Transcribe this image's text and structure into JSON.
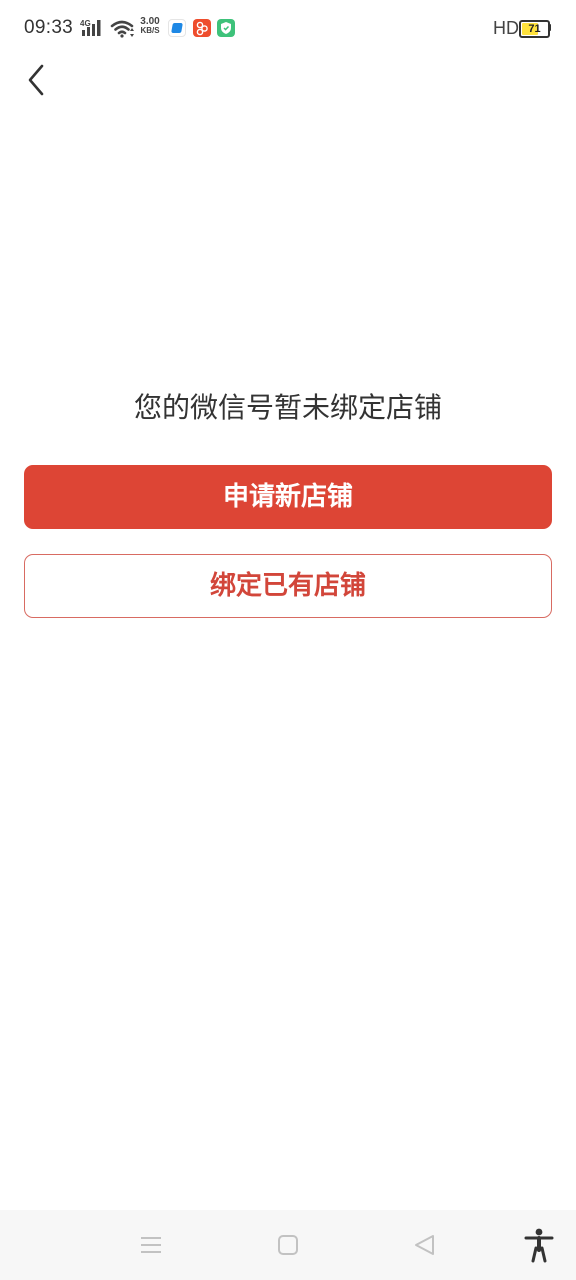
{
  "status_bar": {
    "time": "09:33",
    "network_type": "4G",
    "net_speed_value": "3.00",
    "net_speed_unit": "KB/S",
    "hd_label": "HD",
    "battery_level": "71",
    "battery_fraction": 0.71,
    "battery_fill_color": "#ffe23c",
    "app_icons": [
      "blue-app-icon",
      "orange-app-icon",
      "green-shield-app-icon"
    ]
  },
  "header": {
    "back_icon": "chevron-left-icon"
  },
  "main": {
    "message": "您的微信号暂未绑定店铺",
    "apply_button_label": "申请新店铺",
    "bind_button_label": "绑定已有店铺"
  },
  "colors": {
    "accent": "#dd4535",
    "outline": "#d86b62",
    "text": "#333333"
  },
  "nav_bar": {
    "icons": [
      "menu-icon",
      "home-icon",
      "back-triangle-icon",
      "accessibility-icon"
    ]
  }
}
